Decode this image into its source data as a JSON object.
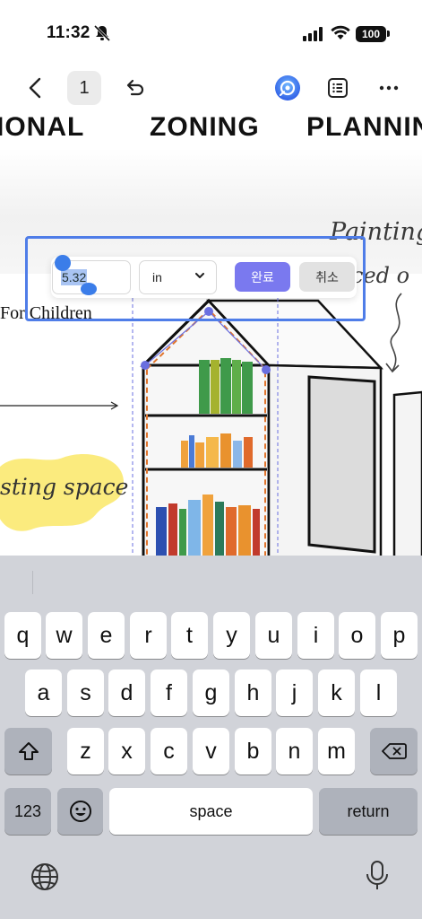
{
  "status_bar": {
    "time": "11:32",
    "battery": "100",
    "icons": [
      "silent-bell-icon",
      "cellular-signal-icon",
      "wifi-icon",
      "battery-icon"
    ]
  },
  "toolbar": {
    "page_number": "1",
    "icons": [
      "back-chevron-icon",
      "undo-icon",
      "ai-assistant-icon",
      "outline-list-icon",
      "more-icon"
    ]
  },
  "document": {
    "headings": [
      "IONAL",
      "ZONING",
      "PLANNIN"
    ],
    "painting_text": "Painting",
    "placed_text": "ced o",
    "for_children": "For Children",
    "resting_text": "sting space"
  },
  "dimension_popup": {
    "value": "5.32",
    "unit": "in",
    "done_label": "완료",
    "cancel_label": "취소"
  },
  "keyboard": {
    "row1": [
      "q",
      "w",
      "e",
      "r",
      "t",
      "y",
      "u",
      "i",
      "o",
      "p"
    ],
    "row2": [
      "a",
      "s",
      "d",
      "f",
      "g",
      "h",
      "j",
      "k",
      "l"
    ],
    "row3": [
      "z",
      "x",
      "c",
      "v",
      "b",
      "n",
      "m"
    ],
    "numbers_key": "123",
    "space_key": "space",
    "return_key": "return",
    "icons": [
      "shift-icon",
      "delete-icon",
      "emoji-icon",
      "globe-icon",
      "microphone-icon"
    ]
  },
  "colors": {
    "accent_blue": "#4f7de8",
    "done_purple": "#7a79ef",
    "highlight_yellow": "#fbeb7e",
    "keyboard_bg": "#d1d3d9"
  }
}
